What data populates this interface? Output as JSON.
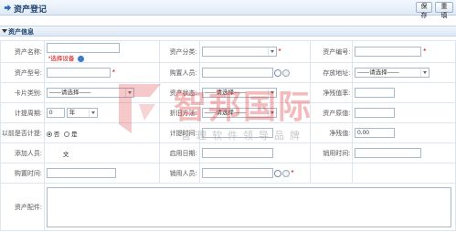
{
  "header": {
    "title": "资产登记",
    "save_label": "保存",
    "reset_label": "重填"
  },
  "section": {
    "title": "资产信息"
  },
  "fields": {
    "asset_name": {
      "label": "资产名称:",
      "value": "",
      "sub_label": "*选择设备"
    },
    "asset_category": {
      "label": "资产分类:",
      "value": ""
    },
    "asset_code": {
      "label": "资产编号:",
      "value": ""
    },
    "asset_model": {
      "label": "资产型号:",
      "value": ""
    },
    "purchaser": {
      "label": "购置人员:",
      "value": ""
    },
    "storage_location": {
      "label": "存放地址:",
      "value": "——请选择——"
    },
    "card_type": {
      "label": "卡片类别:",
      "value": "——请选择——"
    },
    "asset_status": {
      "label": "资产状态:",
      "value": "——请选择——"
    },
    "net_salvage_rate": {
      "label": "净残值率:",
      "value": ""
    },
    "depreciation_period": {
      "label": "计提周期:",
      "value": "0",
      "unit": "年"
    },
    "depreciation_method": {
      "label": "折旧方法:",
      "value": "——请选择——"
    },
    "asset_original_value": {
      "label": "资产原值:",
      "value": ""
    },
    "previously_depreciated": {
      "label": "以前是否计提:",
      "option_no": "否",
      "option_yes": "是",
      "selected": "否"
    },
    "depreciation_time": {
      "label": "计提时间:",
      "value": ""
    },
    "net_salvage": {
      "label": "净残值:",
      "value": "0.00"
    },
    "added_by": {
      "label": "添加人员:",
      "value": "文"
    },
    "enable_date": {
      "label": "启用日期:",
      "value": ""
    },
    "sale_time": {
      "label": "销用时间:",
      "value": ""
    },
    "purchase_time": {
      "label": "购置时间:",
      "value": ""
    },
    "sale_person": {
      "label": "销用人员:",
      "value": ""
    },
    "asset_attachment": {
      "label": "资产配件:",
      "value": ""
    }
  },
  "watermark": {
    "text": "智邦国际",
    "subtext": "管理软件领导品牌"
  },
  "colors": {
    "header_text": "#1d3f6b",
    "required": "#dd0000",
    "accent": "#3b7dc4",
    "watermark": "#dc3c3c"
  }
}
